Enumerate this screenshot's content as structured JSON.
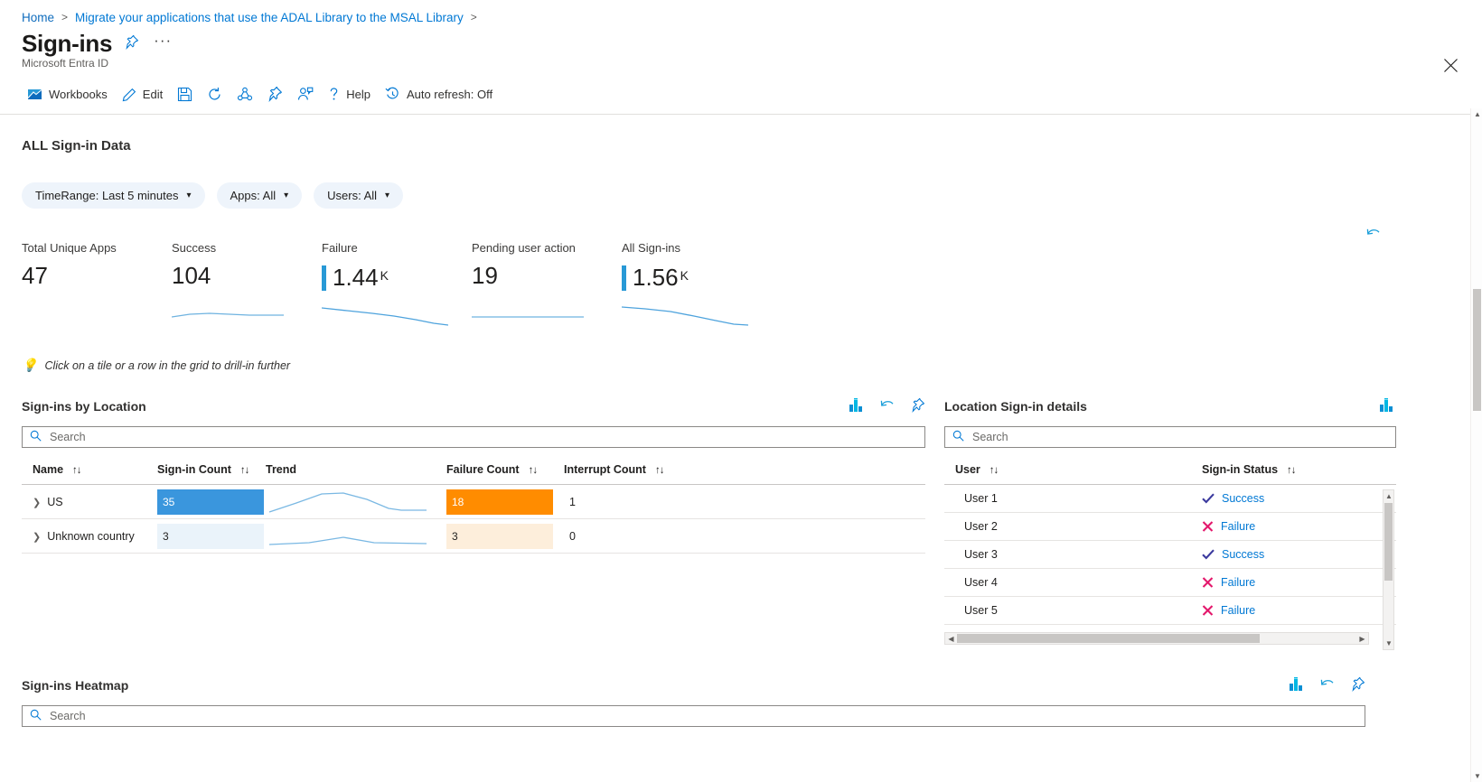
{
  "breadcrumb": {
    "home": "Home",
    "item": "Migrate your applications that use the ADAL Library to the MSAL Library"
  },
  "header": {
    "title": "Sign-ins",
    "subtitle": "Microsoft Entra ID",
    "pin_icon": "pin-icon",
    "more_icon": "ellipsis-icon",
    "close_icon": "close-icon"
  },
  "toolbar": {
    "workbooks": "Workbooks",
    "edit": "Edit",
    "save_icon": "save-icon",
    "refresh_icon": "refresh-icon",
    "share_icon": "share-icon",
    "pin_icon": "pin-icon",
    "add_user_icon": "add-user-icon",
    "help": "Help",
    "auto_refresh": "Auto refresh: Off"
  },
  "section": {
    "title": "ALL Sign-in Data"
  },
  "filters": [
    {
      "label": "TimeRange: Last 5 minutes",
      "name": "filter-timerange"
    },
    {
      "label": "Apps: All",
      "name": "filter-apps"
    },
    {
      "label": "Users: All",
      "name": "filter-users"
    }
  ],
  "tiles": [
    {
      "label": "Total Unique Apps",
      "value": "47",
      "unit": "",
      "accent": false
    },
    {
      "label": "Success",
      "value": "104",
      "unit": "",
      "accent": false
    },
    {
      "label": "Failure",
      "value": "1.44",
      "unit": "K",
      "accent": true
    },
    {
      "label": "Pending user action",
      "value": "19",
      "unit": "",
      "accent": false
    },
    {
      "label": "All Sign-ins",
      "value": "1.56",
      "unit": "K",
      "accent": true
    }
  ],
  "hint": "Click on a tile or a row in the grid to drill-in further",
  "left_panel": {
    "title": "Sign-ins by Location",
    "search_placeholder": "Search",
    "search_value": "",
    "columns": [
      "Name",
      "Sign-in Count",
      "Trend",
      "Failure Count",
      "Interrupt Count"
    ],
    "rows": [
      {
        "name": "US",
        "signin_count": "35",
        "signin_pct": 100,
        "failure_count": "18",
        "failure_pct": 100,
        "interrupt_count": "1"
      },
      {
        "name": "Unknown country",
        "signin_count": "3",
        "signin_pct": 9,
        "failure_count": "3",
        "failure_pct": 17,
        "interrupt_count": "0"
      }
    ]
  },
  "right_panel": {
    "title": "Location Sign-in details",
    "search_placeholder": "Search",
    "search_value": "",
    "columns": [
      "User",
      "Sign-in Status"
    ],
    "rows": [
      {
        "user": "User 1",
        "status": "Success"
      },
      {
        "user": "User 2",
        "status": "Failure"
      },
      {
        "user": "User 3",
        "status": "Success"
      },
      {
        "user": "User 4",
        "status": "Failure"
      },
      {
        "user": "User 5",
        "status": "Failure"
      }
    ]
  },
  "heatmap_panel": {
    "title": "Sign-ins Heatmap",
    "search_placeholder": "Search",
    "search_value": ""
  },
  "colors": {
    "accent": "#0078d4",
    "bar_blue": "#2899d6",
    "bar_blue_light": "#eaf3fa",
    "bar_orange": "#ff8c00",
    "bar_orange_light": "#fdeedb",
    "success": "#3b3a9e",
    "failure": "#e3176b",
    "link": "#0078d4"
  },
  "chart_data": {
    "type": "line",
    "title": "Tile sparklines",
    "series": [
      {
        "name": "Total Unique Apps",
        "values": []
      },
      {
        "name": "Success",
        "values": [
          3,
          3,
          4,
          5,
          4,
          4,
          4,
          4
        ]
      },
      {
        "name": "Failure",
        "values": [
          9,
          8,
          7,
          6,
          5,
          4,
          3,
          1
        ]
      },
      {
        "name": "Pending user action",
        "values": [
          1,
          1,
          1,
          1,
          1,
          1,
          1,
          1
        ]
      },
      {
        "name": "All Sign-ins",
        "values": [
          9,
          9,
          8,
          7,
          6,
          5,
          3,
          1
        ]
      }
    ],
    "grid": false,
    "legend": "none"
  }
}
